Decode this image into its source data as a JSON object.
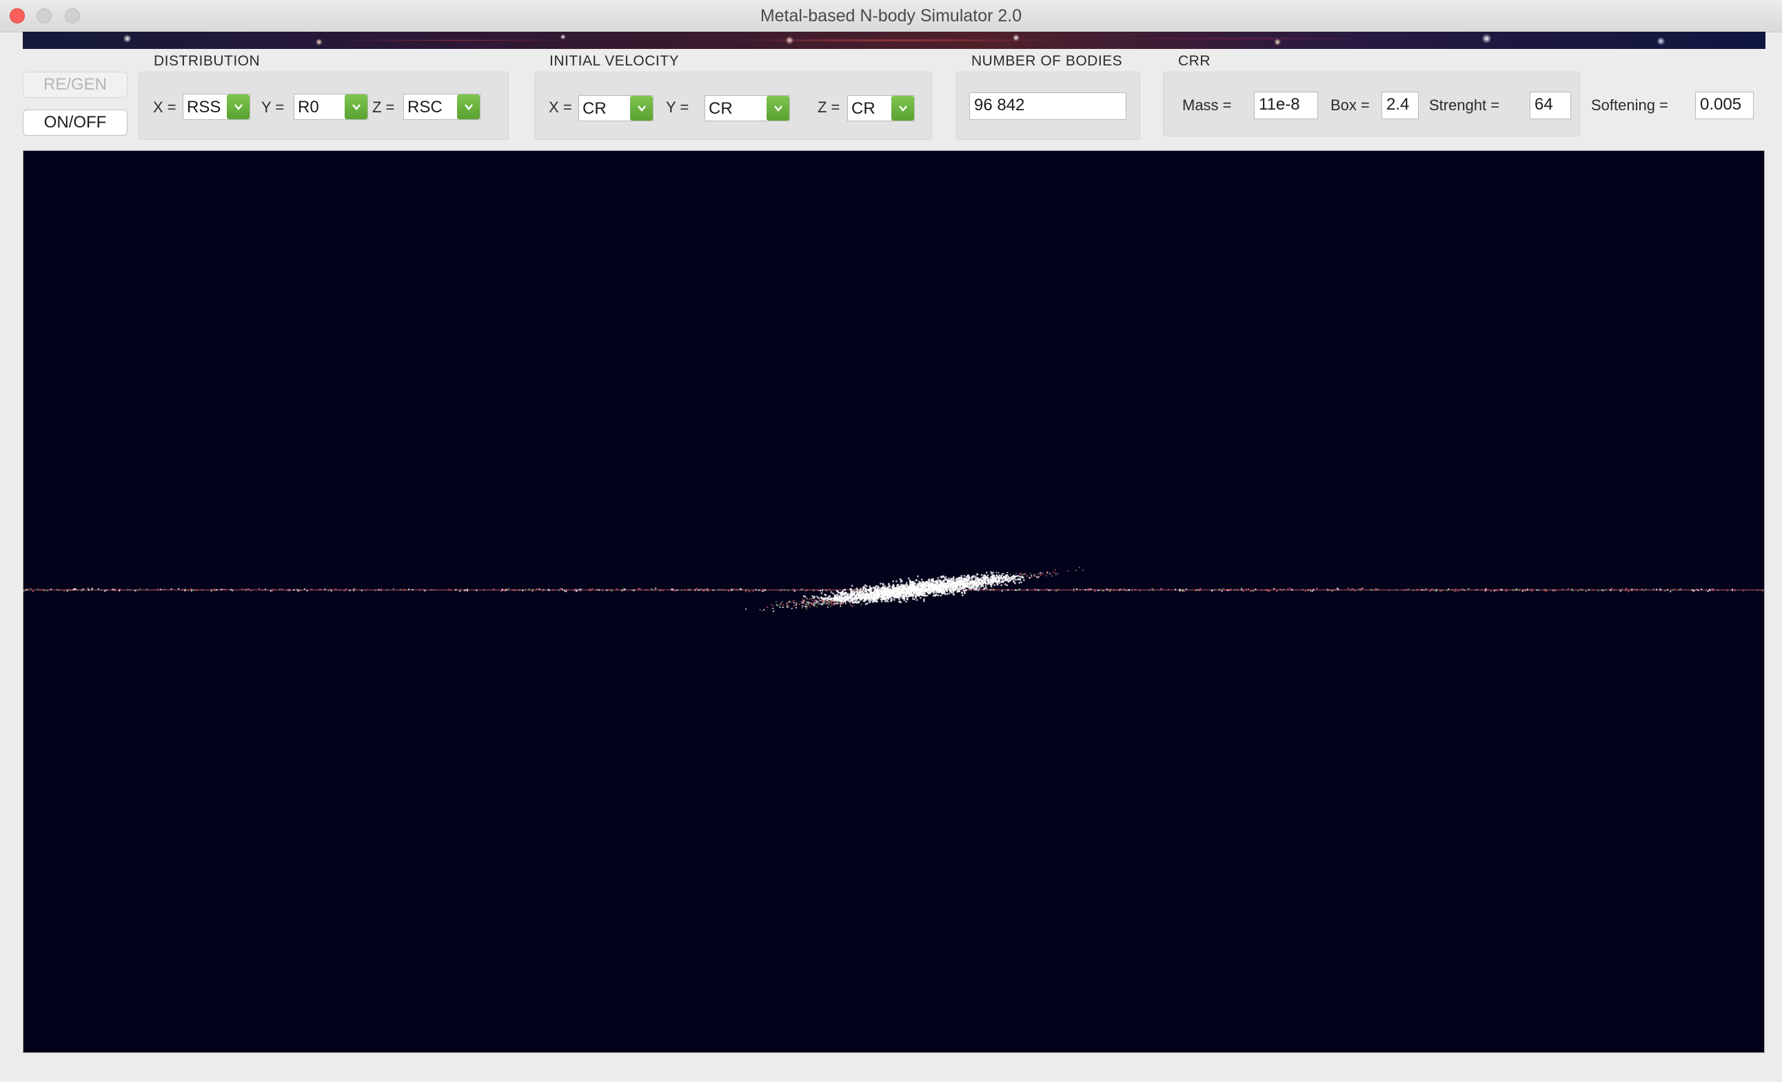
{
  "window": {
    "title": "Metal-based N-body Simulator 2.0"
  },
  "buttons": {
    "regen": "RE/GEN",
    "onoff": "ON/OFF"
  },
  "distribution": {
    "title": "DISTRIBUTION",
    "x_label": "X =",
    "x_value": "RSS",
    "y_label": "Y =",
    "y_value": "R0",
    "z_label": "Z =",
    "z_value": "RSC"
  },
  "initial_velocity": {
    "title": "INITIAL VELOCITY",
    "x_label": "X =",
    "x_value": "CR",
    "y_label": "Y =",
    "y_value": "CR",
    "z_label": "Z =",
    "z_value": "CR"
  },
  "bodies": {
    "title": "NUMBER OF BODIES",
    "value": "96 842"
  },
  "crr": {
    "title": "CRR",
    "mass_label": "Mass =",
    "mass_value": "11e-8",
    "box_label": "Box =",
    "box_value": "2.4",
    "strength_label": "Strenght =",
    "strength_value": "64",
    "softening_label": "Softening =",
    "softening_value": "0.005"
  },
  "simulation": {
    "background_color": "#02021a",
    "particle_colors": [
      "#d46a8a",
      "#ffffff",
      "#7ea06a",
      "#c85a5a"
    ]
  },
  "icons": {
    "dropdown": "chevron-down-icon",
    "close": "close-icon",
    "minimize": "minimize-icon",
    "zoom": "zoom-icon"
  }
}
